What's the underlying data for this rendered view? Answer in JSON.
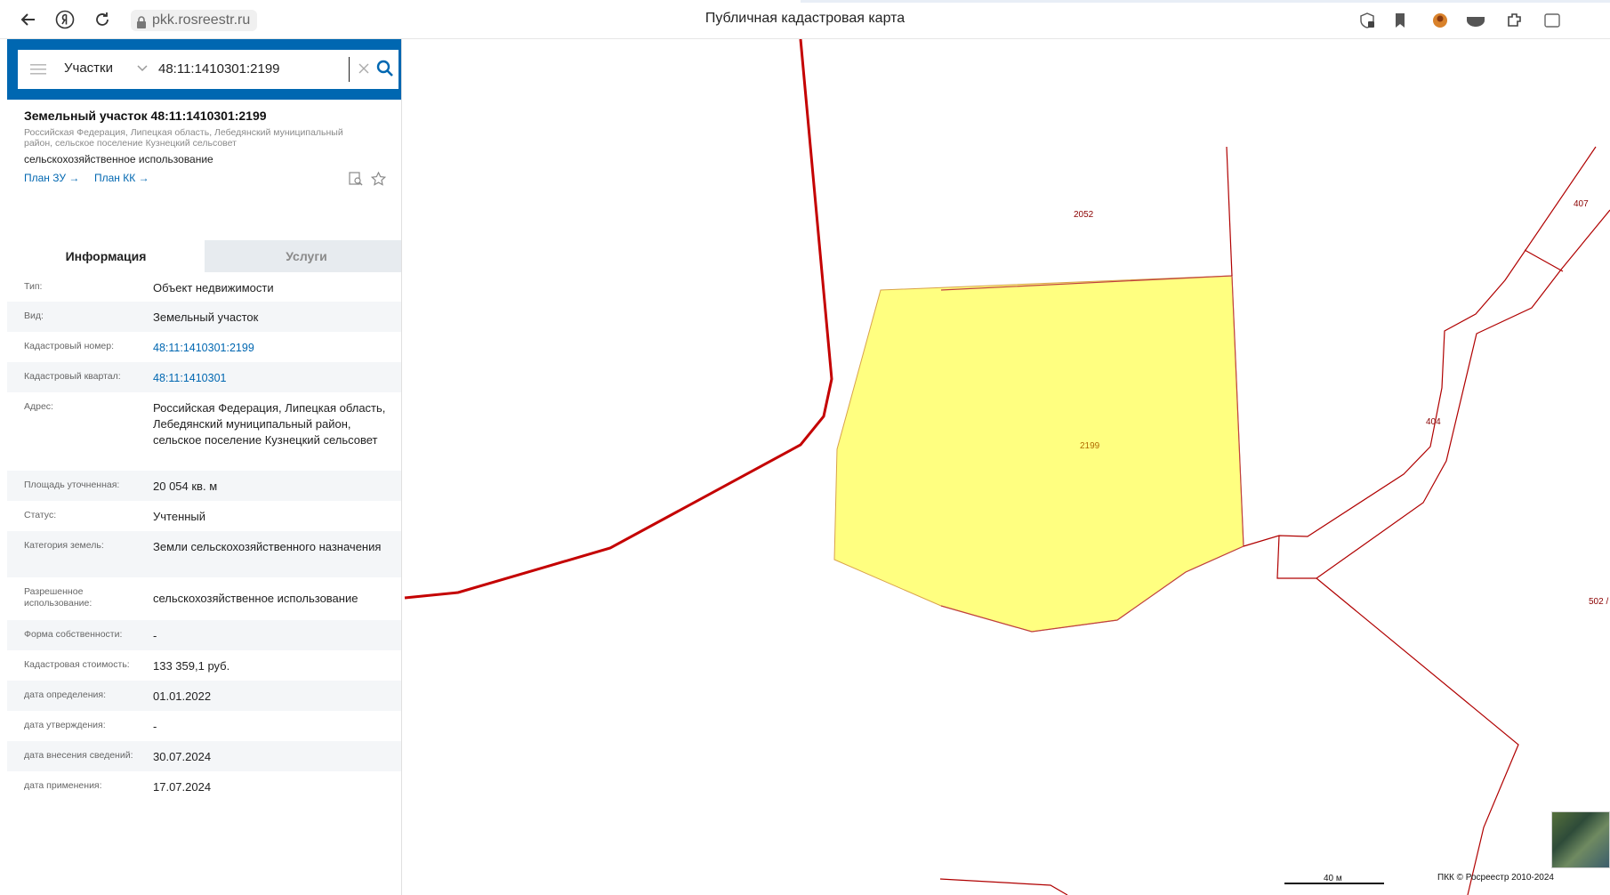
{
  "browser": {
    "url": "pkk.rosreestr.ru",
    "title": "Публичная кадастровая карта"
  },
  "search": {
    "select_label": "Участки",
    "query": "48:11:1410301:2199"
  },
  "parcel": {
    "title": "Земельный участок 48:11:1410301:2199",
    "address_line": "Российская Федерация, Липецкая область, Лебедянский муниципальный район, сельское поселение Кузнецкий сельсовет",
    "use": "сельскохозяйственное использование",
    "links": [
      "План ЗУ →",
      "План КК →"
    ]
  },
  "tabs": [
    {
      "label": "Информация",
      "active": true
    },
    {
      "label": "Услуги",
      "active": false
    }
  ],
  "info_rows": [
    {
      "key": "Тип:",
      "value": "Объект недвижимости"
    },
    {
      "key": "Вид:",
      "value": "Земельный участок"
    },
    {
      "key": "Кадастровый номер:",
      "value": "48:11:1410301:2199",
      "link": true
    },
    {
      "key": "Кадастровый квартал:",
      "value": "48:11:1410301",
      "link": true
    },
    {
      "key": "Адрес:",
      "value": "Российская Федерация, Липецкая область, Лебедянский муниципальный район, сельское поселение Кузнецкий сельсовет"
    },
    {
      "key": "Площадь уточненная:",
      "value": "20 054 кв. м"
    },
    {
      "key": "Статус:",
      "value": "Учтенный"
    },
    {
      "key": "Категория земель:",
      "value": "Земли сельскохозяйственного назначения"
    },
    {
      "key": "Разрешенное использование:",
      "value": "сельскохозяйственное использование"
    },
    {
      "key": "Форма собственности:",
      "value": "-"
    },
    {
      "key": "Кадастровая стоимость:",
      "value": "133 359,1 руб."
    },
    {
      "key": "дата определения:",
      "value": "01.01.2022"
    },
    {
      "key": "дата утверждения:",
      "value": "-"
    },
    {
      "key": "дата внесения сведений:",
      "value": "30.07.2024"
    },
    {
      "key": "дата применения:",
      "value": "17.07.2024"
    }
  ],
  "map": {
    "labels": {
      "l2052": "2052",
      "l2199": "2199",
      "l407": "407",
      "l404": "404",
      "l502": "502 /"
    },
    "scale": "40 м",
    "copyright": "ПКК © Росреестр 2010-2024"
  },
  "colors": {
    "brand_blue": "#0067b1",
    "parcel_fill": "#ffff80",
    "boundary_red": "#c00000"
  }
}
